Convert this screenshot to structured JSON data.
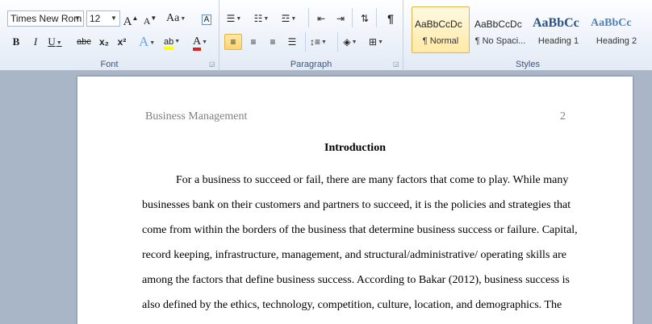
{
  "font_group": {
    "label": "Font",
    "font_name": "Times New Rom",
    "font_size": "12",
    "grow": "A",
    "shrink": "A",
    "change_case": "Aa",
    "clear_format": "A",
    "bold": "B",
    "italic": "I",
    "underline": "U",
    "strikethrough": "abc",
    "subscript": "x₂",
    "superscript": "x²",
    "text_effects": "A",
    "highlight": "ab",
    "font_color": "A"
  },
  "paragraph_group": {
    "label": "Paragraph",
    "pilcrow": "¶"
  },
  "styles_group": {
    "label": "Styles",
    "items": [
      {
        "sample": "AaBbCcDc",
        "name": "¶ Normal"
      },
      {
        "sample": "AaBbCcDc",
        "name": "¶ No Spaci..."
      },
      {
        "sample": "AaBbCc",
        "name": "Heading 1"
      },
      {
        "sample": "AaBbCc",
        "name": "Heading 2"
      }
    ]
  },
  "document": {
    "header_left": "Business Management",
    "header_page": "2",
    "heading": "Introduction",
    "lines": [
      "For a business to succeed or fail, there are many factors that come to play. While many",
      "businesses bank on their customers and partners to succeed, it is the policies and strategies that",
      "come from within the borders of the business that determine business success or failure. Capital,",
      "record keeping, infrastructure, management, and structural/administrative/ operating skills are",
      "among the factors that define business success. According to Bakar (2012), business success is",
      "also defined by the ethics, technology, competition, culture, location, and demographics. The"
    ]
  },
  "colors": {
    "highlight": "#ffff00",
    "font_color": "#e0201b",
    "heading_style": "#2a4f85",
    "selected": "#ffd56b"
  }
}
